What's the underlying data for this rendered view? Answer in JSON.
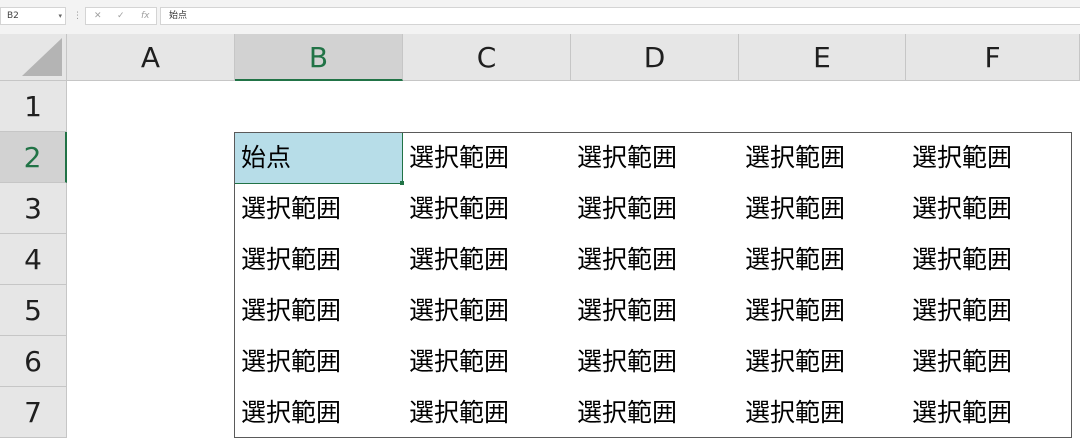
{
  "formula_bar": {
    "name_box": "B2",
    "formula": "始点",
    "icons": [
      "cancel-icon",
      "enter-icon",
      "insert-function-icon"
    ],
    "icon_glyphs": {
      "cancel": "✕",
      "enter": "✓",
      "fx": "fx"
    },
    "separator": "⋮"
  },
  "sheet": {
    "columns": [
      "A",
      "B",
      "C",
      "D",
      "E",
      "F"
    ],
    "rows": [
      "1",
      "2",
      "3",
      "4",
      "5",
      "6",
      "7"
    ],
    "active_cell": "B2",
    "selected_column": "B",
    "selected_row": "2",
    "cells": {
      "B2": "始点",
      "range_text": "選択範囲"
    }
  },
  "colors": {
    "accent": "#217346",
    "active_fill": "#b7dde8",
    "header_bg": "#e6e6e6"
  }
}
